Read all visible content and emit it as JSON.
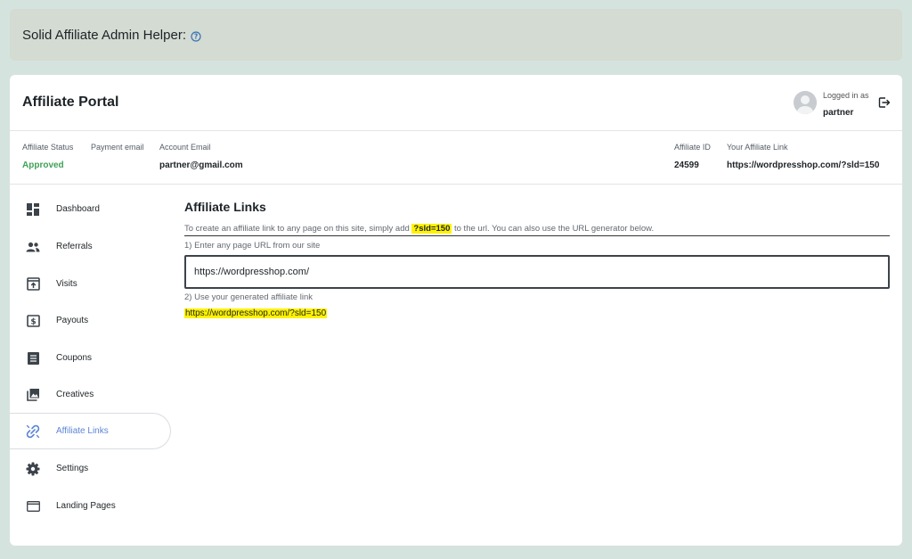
{
  "helper": {
    "title": "Solid Affiliate Admin Helper:",
    "help_icon": "question-circle-icon"
  },
  "portal": {
    "title": "Affiliate Portal",
    "user": {
      "logged_in_label": "Logged in as",
      "username": "partner",
      "avatar_icon": "user-avatar-icon",
      "logout_icon": "logout-icon"
    }
  },
  "info": {
    "status_label": "Affiliate Status",
    "status_value": "Approved",
    "payment_email_label": "Payment email",
    "account_email_label": "Account Email",
    "account_email_value": "partner@gmail.com",
    "affiliate_id_label": "Affiliate ID",
    "affiliate_id_value": "24599",
    "affiliate_link_label": "Your Affiliate Link",
    "affiliate_link_value": "https://wordpresshop.com/?sld=150"
  },
  "sidebar": {
    "items": [
      {
        "label": "Dashboard",
        "icon": "dashboard-icon"
      },
      {
        "label": "Referrals",
        "icon": "users-icon"
      },
      {
        "label": "Visits",
        "icon": "visits-icon"
      },
      {
        "label": "Payouts",
        "icon": "dollar-icon"
      },
      {
        "label": "Coupons",
        "icon": "coupon-icon"
      },
      {
        "label": "Creatives",
        "icon": "images-icon"
      },
      {
        "label": "Affiliate Links",
        "icon": "link-icon",
        "active": true
      },
      {
        "label": "Settings",
        "icon": "gear-icon"
      },
      {
        "label": "Landing Pages",
        "icon": "window-icon"
      }
    ]
  },
  "main": {
    "title": "Affiliate Links",
    "desc_before": "To create an affiliate link to any page on this site, simply add ",
    "desc_param": "?sld=150",
    "desc_after": " to the url. You can also use the URL generator below.",
    "step1_label": "1) Enter any page URL from our site",
    "url_input_value": "https://wordpresshop.com/",
    "step2_label": "2) Use your generated affiliate link",
    "generated_link": "https://wordpresshop.com/?sld=150"
  },
  "colors": {
    "accent": "#5b85d6",
    "approved": "#3fa157",
    "highlight": "#fff200",
    "background": "#d5e3de"
  }
}
